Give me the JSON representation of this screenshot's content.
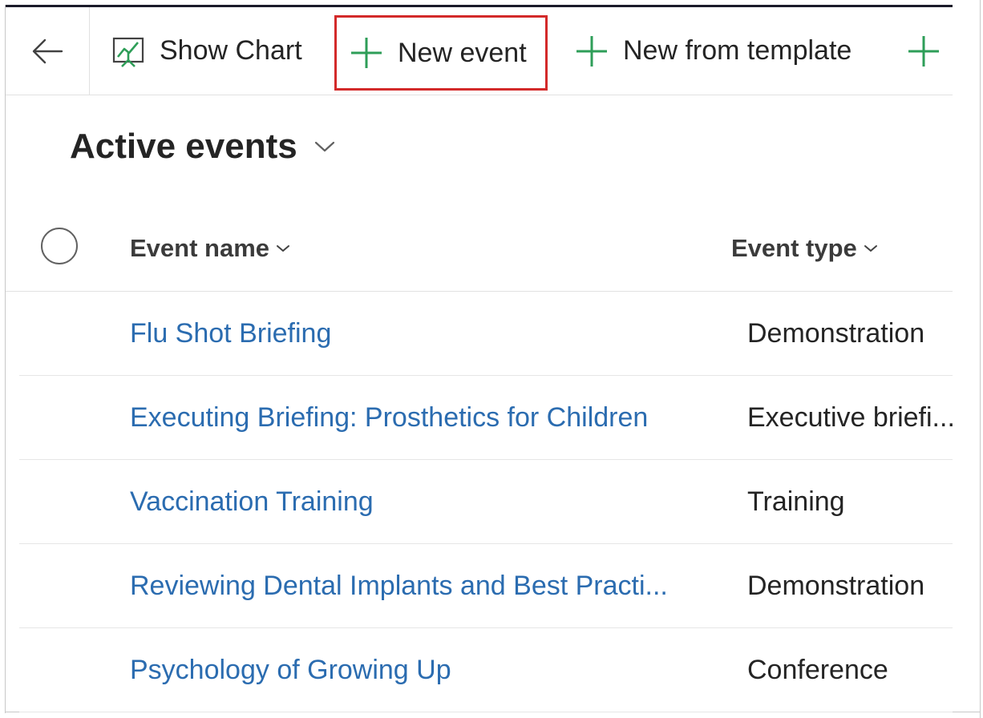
{
  "commandbar": {
    "show_chart_label": "Show Chart",
    "new_event_label": "New event",
    "new_from_template_label": "New from template"
  },
  "view": {
    "title": "Active events"
  },
  "grid": {
    "columns": [
      "Event name",
      "Event type"
    ],
    "rows": [
      {
        "name": "Flu Shot Briefing",
        "type": "Demonstration"
      },
      {
        "name": "Executing Briefing: Prosthetics for Children",
        "type": "Executive briefi..."
      },
      {
        "name": "Vaccination Training",
        "type": "Training"
      },
      {
        "name": "Reviewing Dental Implants and Best Practi...",
        "type": "Demonstration"
      },
      {
        "name": "Psychology of Growing Up",
        "type": "Conference"
      }
    ]
  },
  "colors": {
    "accent_green": "#2e9e58",
    "link_blue": "#2b6cb0",
    "highlight_red": "#d32a2a"
  },
  "icons": [
    "back-arrow-icon",
    "chart-icon",
    "plus-icon",
    "chevron-down-icon"
  ]
}
